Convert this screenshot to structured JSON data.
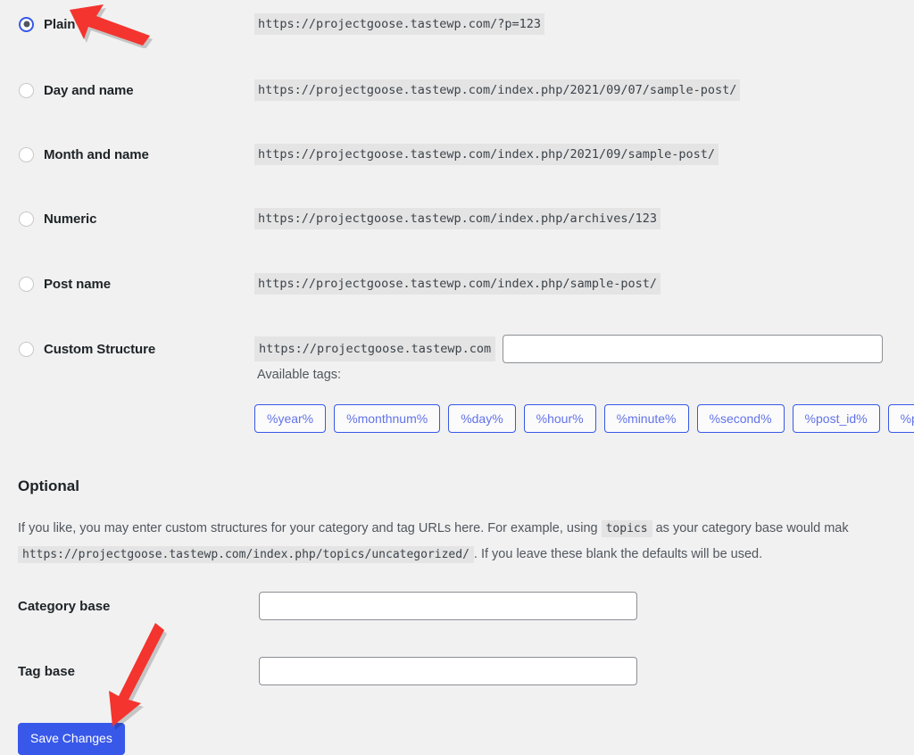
{
  "permalink": {
    "options": [
      {
        "label": "Plain",
        "url": "https://projectgoose.tastewp.com/?p=123",
        "selected": true
      },
      {
        "label": "Day and name",
        "url": "https://projectgoose.tastewp.com/index.php/2021/09/07/sample-post/",
        "selected": false
      },
      {
        "label": "Month and name",
        "url": "https://projectgoose.tastewp.com/index.php/2021/09/sample-post/",
        "selected": false
      },
      {
        "label": "Numeric",
        "url": "https://projectgoose.tastewp.com/index.php/archives/123",
        "selected": false
      },
      {
        "label": "Post name",
        "url": "https://projectgoose.tastewp.com/index.php/sample-post/",
        "selected": false
      },
      {
        "label": "Custom Structure",
        "url": "https://projectgoose.tastewp.com",
        "selected": false
      }
    ],
    "custom_structure_value": "",
    "custom_structure_placeholder": "",
    "available_tags_label": "Available tags:",
    "tags": [
      "%year%",
      "%monthnum%",
      "%day%",
      "%hour%",
      "%minute%",
      "%second%",
      "%post_id%",
      "%postname%"
    ]
  },
  "optional": {
    "heading": "Optional",
    "text_part1": "If you like, you may enter custom structures for your category and tag URLs here. For example, using",
    "code_topics": "topics",
    "text_part2": "as your category base would mak",
    "code_example_url": "https://projectgoose.tastewp.com/index.php/topics/uncategorized/",
    "text_part3": ". If you leave these blank the defaults will be used.",
    "category_base": {
      "label": "Category base",
      "value": "",
      "placeholder": ""
    },
    "tag_base": {
      "label": "Tag base",
      "value": "",
      "placeholder": ""
    }
  },
  "actions": {
    "save_label": "Save Changes"
  },
  "colors": {
    "accent": "#3858e9",
    "annotation": "#f4342e",
    "page_background": "#f1f1f1",
    "code_background": "#e4e4e4"
  }
}
